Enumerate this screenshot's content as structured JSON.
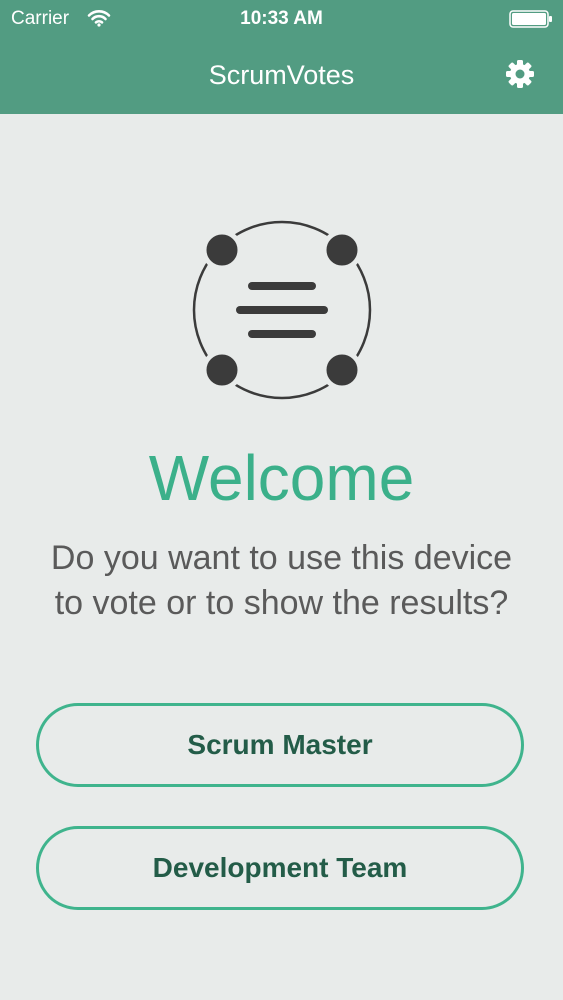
{
  "status_bar": {
    "carrier": "Carrier",
    "time": "10:33 AM",
    "wifi_icon": "wifi-icon",
    "battery_icon": "battery-icon"
  },
  "nav": {
    "title": "ScrumVotes",
    "settings_icon": "gear-icon"
  },
  "main": {
    "logo_icon": "scrumvotes-logo-icon",
    "welcome": "Welcome",
    "question": "Do you want to use this device to vote or to show the results?"
  },
  "buttons": {
    "scrum_master": "Scrum Master",
    "development_team": "Development Team"
  },
  "colors": {
    "nav_bar": "#529c82",
    "background": "#e8ebea",
    "accent": "#3bb08a",
    "button_text": "#235c48",
    "body_text": "#5a5a5a",
    "logo": "#3b3b3b"
  }
}
